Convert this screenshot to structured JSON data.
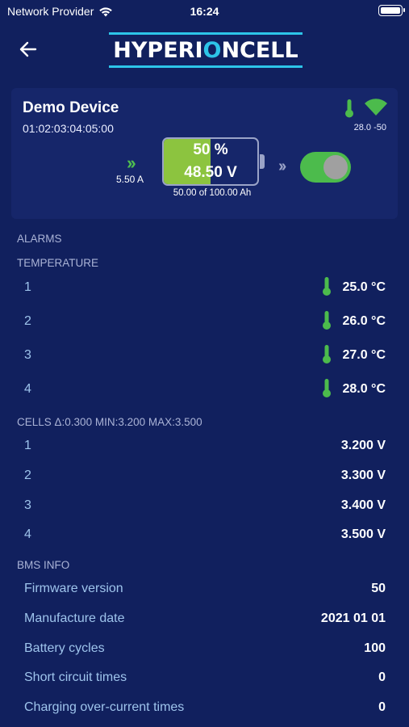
{
  "status_bar": {
    "carrier": "Network Provider",
    "time": "16:24"
  },
  "header": {
    "logo_left": "HYPERI",
    "logo_mid": "O",
    "logo_right": "NCELL",
    "back_icon": "back-arrow-icon"
  },
  "device": {
    "name": "Demo Device",
    "mac": "01:02:03:04:05:00",
    "temp_wifi": "28.0  -50",
    "current": "5.50 A",
    "battery_percent": "50 %",
    "battery_fill": 0.5,
    "voltage": "48.50 V",
    "capacity": "50.00 of 100.00 Ah",
    "switch_on": true,
    "accent_green": "#4cbb4c",
    "battery_green": "#8cc43f"
  },
  "alarms": {
    "title": "ALARMS"
  },
  "temperature": {
    "title": "TEMPERATURE",
    "rows": [
      {
        "index": "1",
        "value": "25.0 °C"
      },
      {
        "index": "2",
        "value": "26.0 °C"
      },
      {
        "index": "3",
        "value": "27.0 °C"
      },
      {
        "index": "4",
        "value": "28.0 °C"
      }
    ]
  },
  "cells": {
    "title": "CELLS  Δ:0.300 MIN:3.200 MAX:3.500",
    "rows": [
      {
        "index": "1",
        "value": "3.200 V"
      },
      {
        "index": "2",
        "value": "3.300 V"
      },
      {
        "index": "3",
        "value": "3.400 V"
      },
      {
        "index": "4",
        "value": "3.500 V"
      }
    ]
  },
  "bms": {
    "title": "BMS INFO",
    "rows": [
      {
        "label": "Firmware version",
        "value": "50"
      },
      {
        "label": "Manufacture date",
        "value": "2021 01 01"
      },
      {
        "label": "Battery cycles",
        "value": "100"
      },
      {
        "label": "Short circuit times",
        "value": "0"
      },
      {
        "label": "Charging over-current times",
        "value": "0"
      }
    ]
  }
}
